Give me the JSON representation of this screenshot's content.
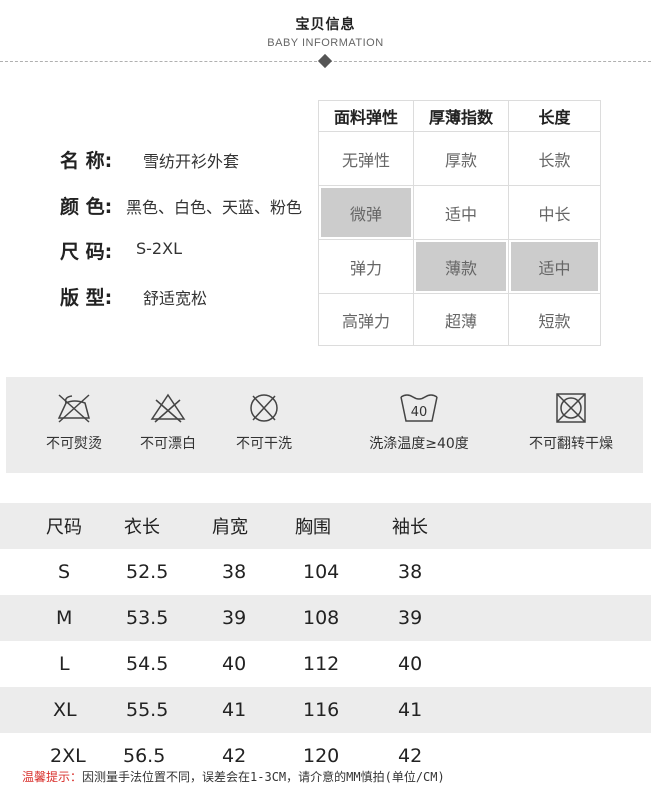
{
  "header": {
    "title": "宝贝信息",
    "subtitle": "BABY INFORMATION"
  },
  "info": [
    {
      "label": "名 称:",
      "value": "雪纺开衫外套"
    },
    {
      "label": "颜 色:",
      "value": "黑色、白色、天蓝、粉色"
    },
    {
      "label": "尺 码:",
      "value": "S-2XL"
    },
    {
      "label": "版 型:",
      "value": "舒适宽松"
    }
  ],
  "fabric_table": {
    "headers": [
      "面料弹性",
      "厚薄指数",
      "长度"
    ],
    "rows": [
      [
        "无弹性",
        "厚款",
        "长款"
      ],
      [
        "微弹",
        "适中",
        "中长"
      ],
      [
        "弹力",
        "薄款",
        "适中"
      ],
      [
        "高弹力",
        "超薄",
        "短款"
      ]
    ],
    "selected": {
      "elasticity": "微弹",
      "thickness": "薄款",
      "length": "适中"
    }
  },
  "care": [
    {
      "icon": "no-iron-icon",
      "label": "不可熨烫"
    },
    {
      "icon": "no-bleach-icon",
      "label": "不可漂白"
    },
    {
      "icon": "no-dry-clean-icon",
      "label": "不可干洗"
    },
    {
      "icon": "wash-40-icon",
      "label": "洗涤温度≥40度",
      "temp": "40"
    },
    {
      "icon": "no-tumble-dry-icon",
      "label": "不可翻转干燥"
    }
  ],
  "size_table": {
    "headers": [
      "尺码",
      "衣长",
      "肩宽",
      "胸围",
      "袖长"
    ],
    "rows": [
      [
        "S",
        "52.5",
        "38",
        "104",
        "38"
      ],
      [
        "M",
        "53.5",
        "39",
        "108",
        "39"
      ],
      [
        "L",
        "54.5",
        "40",
        "112",
        "40"
      ],
      [
        "XL",
        "55.5",
        "41",
        "116",
        "41"
      ],
      [
        "2XL",
        "56.5",
        "42",
        "120",
        "42"
      ]
    ]
  },
  "note": {
    "prefix": "温馨提示：",
    "text": "因测量手法位置不同，误差会在1-3CM，请介意的MM慎拍(单位/CM)"
  },
  "colors": {
    "highlight": "#cccccc",
    "band": "#ececec",
    "note_red": "#d9302c"
  }
}
